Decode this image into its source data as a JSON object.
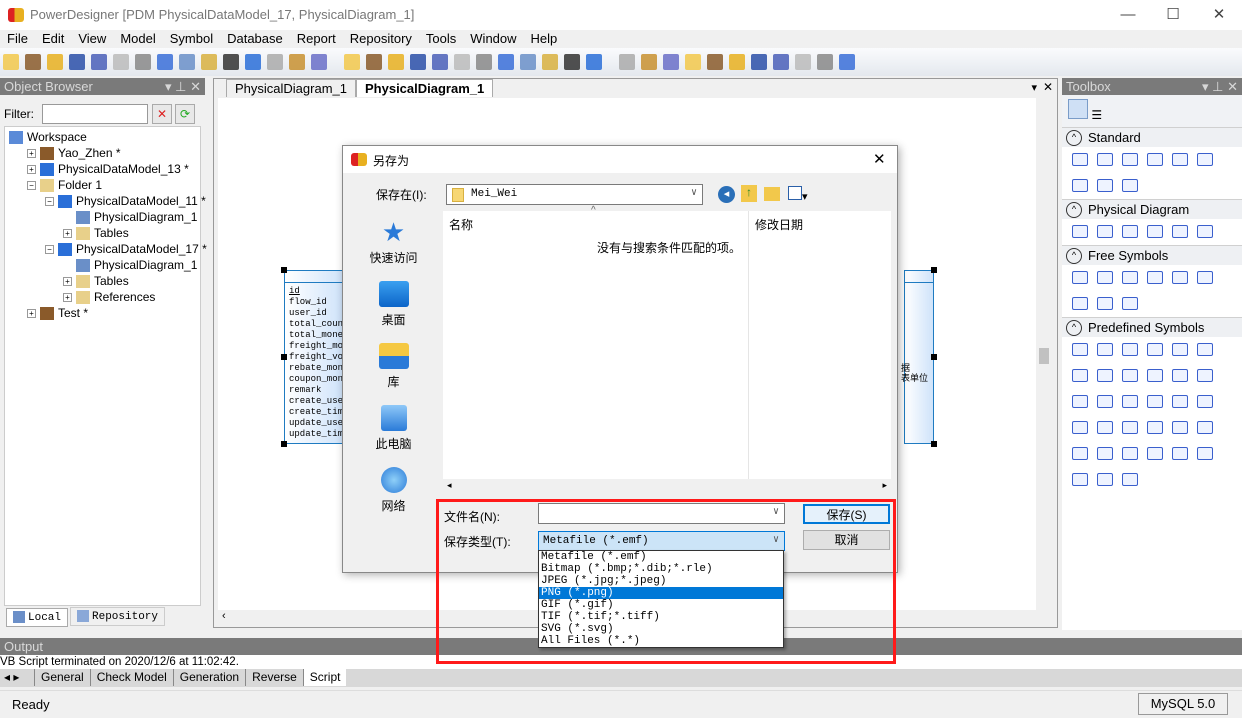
{
  "window": {
    "title": "PowerDesigner [PDM PhysicalDataModel_17, PhysicalDiagram_1]",
    "minimize": "—",
    "maximize": "☐",
    "close": "✕"
  },
  "menu": [
    "File",
    "Edit",
    "View",
    "Model",
    "Symbol",
    "Database",
    "Report",
    "Repository",
    "Tools",
    "Window",
    "Help"
  ],
  "toolbar": {
    "icons": [
      "new-icon",
      "open-model-icon",
      "open-folder-icon",
      "save-icon",
      "save-all-icon",
      "print-preview-icon",
      "print-icon",
      "cut-icon",
      "copy-icon",
      "paste-icon",
      "delete-icon",
      "undo-icon",
      "redo-icon",
      "properties-icon",
      "help-icon",
      "new-diagram-icon",
      "paste-as-shortcut-icon",
      "find-icon",
      "refresh-icon",
      "check-icon",
      "shadow-icon",
      "text-icon",
      "brush-icon",
      "fill-icon",
      "font-icon",
      "arrow-left-icon",
      "arrow-right-icon",
      "align-icon",
      "align2-icon",
      "align3-icon",
      "align4-icon",
      "align5-icon",
      "align6-icon",
      "select-icon",
      "view-icon",
      "list-icon",
      "print2-icon",
      "print3-icon"
    ]
  },
  "object_browser": {
    "title": "Object Browser",
    "filter_label": "Filter:",
    "filter_value": "",
    "tree": [
      {
        "label": "Workspace",
        "level": 0,
        "icon": "workspace-icon",
        "toggle": ""
      },
      {
        "label": "Yao_Zhen *",
        "level": 1,
        "icon": "briefcase-icon",
        "toggle": "+"
      },
      {
        "label": "PhysicalDataModel_13 *",
        "level": 1,
        "icon": "pdm-icon",
        "toggle": "+"
      },
      {
        "label": "Folder 1",
        "level": 1,
        "icon": "folder-icon",
        "toggle": "−"
      },
      {
        "label": "PhysicalDataModel_11 *",
        "level": 2,
        "icon": "pdm-icon",
        "toggle": "−"
      },
      {
        "label": "PhysicalDiagram_1",
        "level": 3,
        "icon": "diagram-icon",
        "toggle": ""
      },
      {
        "label": "Tables",
        "level": 3,
        "icon": "folder-icon",
        "toggle": "+"
      },
      {
        "label": "PhysicalDataModel_17 *",
        "level": 2,
        "icon": "pdm-icon",
        "toggle": "−"
      },
      {
        "label": "PhysicalDiagram_1",
        "level": 3,
        "icon": "diagram-icon",
        "toggle": ""
      },
      {
        "label": "Tables",
        "level": 3,
        "icon": "folder-icon",
        "toggle": "+"
      },
      {
        "label": "References",
        "level": 3,
        "icon": "folder-icon",
        "toggle": "+"
      },
      {
        "label": "Test *",
        "level": 1,
        "icon": "briefcase-icon",
        "toggle": "+"
      }
    ],
    "tabs": [
      "Local",
      "Repository"
    ]
  },
  "diagram": {
    "tabs": [
      "PhysicalDiagram_1",
      "PhysicalDiagram_1"
    ],
    "active_tab": 1,
    "entity_columns": [
      "id",
      "flow_id",
      "user_id",
      "total_count",
      "total_money",
      "freight_mon",
      "freight_vou",
      "rebate_mone",
      "coupon_mone",
      "remark",
      "create_user",
      "create_time",
      "update_user",
      "update_time"
    ],
    "right_entity_text": [
      "据",
      "表单位"
    ]
  },
  "toolbox": {
    "title": "Toolbox",
    "sections": [
      {
        "title": "Standard",
        "icons": [
          "pointer-icon",
          "grabber-icon",
          "zoom-in-icon",
          "zoom-out-icon",
          "open-package-icon",
          "properties-icon",
          "delete-icon",
          "note-icon",
          "link-icon"
        ]
      },
      {
        "title": "Physical Diagram",
        "icons": [
          "package-icon",
          "table-icon",
          "view-icon",
          "reference-icon",
          "procedure-icon",
          "file-icon"
        ]
      },
      {
        "title": "Free Symbols",
        "icons": [
          "title-icon",
          "text-icon",
          "line-icon",
          "arc-icon",
          "rectangle-icon",
          "ellipse-icon",
          "rounded-rectangle-icon",
          "polyline-icon",
          "polygon-icon"
        ]
      },
      {
        "title": "Predefined Symbols",
        "icons": [
          "shape-1",
          "shape-2",
          "shape-3",
          "shape-4",
          "shape-5",
          "shape-6",
          "shape-7",
          "shape-8",
          "shape-9",
          "shape-10",
          "shape-11",
          "shape-12",
          "shape-13",
          "shape-14",
          "shape-15",
          "shape-16",
          "shape-17",
          "shape-18",
          "shape-19",
          "shape-20",
          "shape-21",
          "shape-22",
          "shape-23",
          "shape-24",
          "shape-25",
          "shape-26",
          "shape-27",
          "shape-28",
          "shape-29",
          "shape-30",
          "shape-31",
          "shape-32",
          "shape-33"
        ]
      }
    ]
  },
  "output": {
    "title": "Output",
    "message": "VB Script terminated on 2020/12/6 at 11:02:42.",
    "tabs": [
      "General",
      "Check Model",
      "Generation",
      "Reverse",
      "Script"
    ],
    "active_tab": 4
  },
  "status": {
    "text": "Ready",
    "dbms": "MySQL 5.0"
  },
  "dialog": {
    "title": "另存为",
    "save_in_label": "保存在(I):",
    "save_in_value": "Mei_Wei",
    "places": [
      "快速访问",
      "桌面",
      "库",
      "此电脑",
      "网络"
    ],
    "columns": [
      "名称",
      "修改日期"
    ],
    "empty_message": "没有与搜索条件匹配的项。",
    "filename_label": "文件名(N):",
    "filename_value": "",
    "filetype_label": "保存类型(T):",
    "filetype_value": "Metafile (*.emf)",
    "save_button": "保存(S)",
    "cancel_button": "取消",
    "filetype_options": [
      "Metafile (*.emf)",
      "Bitmap (*.bmp;*.dib;*.rle)",
      "JPEG (*.jpg;*.jpeg)",
      "PNG (*.png)",
      "GIF (*.gif)",
      "TIF (*.tif;*.tiff)",
      "SVG (*.svg)",
      "All Files (*.*)"
    ],
    "highlighted_option": 3
  },
  "colors": {
    "accent": "#0078d7",
    "highlight_box": "#ff1a1a",
    "entity_border": "#1f7bc1"
  }
}
